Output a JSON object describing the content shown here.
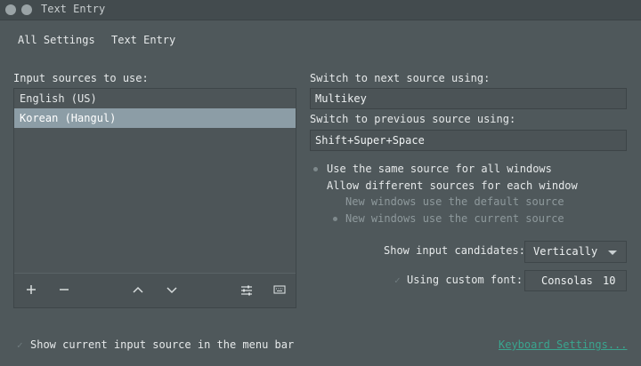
{
  "window": {
    "title": "Text Entry"
  },
  "breadcrumb": [
    "All Settings",
    "Text Entry"
  ],
  "sources": {
    "header": "Input sources to use:",
    "items": [
      {
        "label": "English (US)",
        "selected": false
      },
      {
        "label": "Korean (Hangul)",
        "selected": true
      }
    ],
    "toolbar": [
      "add-icon",
      "remove-icon",
      "chevron-up-icon",
      "chevron-down-icon",
      "sliders-icon",
      "keyboard-icon"
    ]
  },
  "switching": {
    "next_label": "Switch to next source using:",
    "next_value": "Multikey",
    "prev_label": "Switch to previous source using:",
    "prev_value": "Shift+Super+Space",
    "options": [
      "Use the same source for all windows",
      "Allow different sources for each window",
      "New windows use the default source",
      "New windows use the current source"
    ]
  },
  "candidates": {
    "label": "Show input candidates:",
    "value": "Vertically"
  },
  "custom_font": {
    "label": "Using custom font:",
    "font_name": "Consolas",
    "font_size": "10"
  },
  "footer": {
    "menu_bar_label": "Show current input source in the menu bar",
    "keyboard_link": "Keyboard Settings..."
  },
  "colors": {
    "background": "#4f585b",
    "selected_row": "#8c9da6",
    "link": "#3aa58f"
  }
}
